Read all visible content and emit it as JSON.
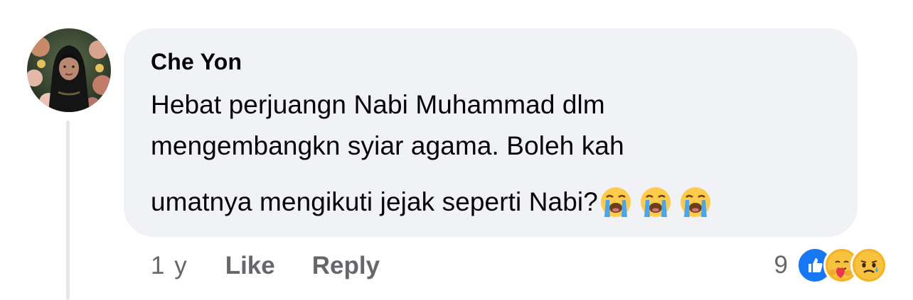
{
  "comment": {
    "author": "Che Yon",
    "text_lines": [
      "Hebat perjuangn Nabi Muhammad dlm",
      "mengembangkn syiar agama. Boleh kah",
      "umatnya mengikuti jejak seperti Nabi?"
    ],
    "emojis": [
      "loudly-crying-face-icon",
      "loudly-crying-face-icon",
      "loudly-crying-face-icon"
    ]
  },
  "actions": {
    "timestamp": "1 y",
    "like_label": "Like",
    "reply_label": "Reply"
  },
  "reactions": {
    "count": "9",
    "icons": [
      "like-reaction-icon",
      "care-reaction-icon",
      "sad-reaction-icon"
    ]
  },
  "colors": {
    "bubble_bg": "#f0f2f5",
    "text": "#050505",
    "secondary_text": "#65676b",
    "like_blue": "#1877f2",
    "thread_line": "#e4e6eb"
  }
}
